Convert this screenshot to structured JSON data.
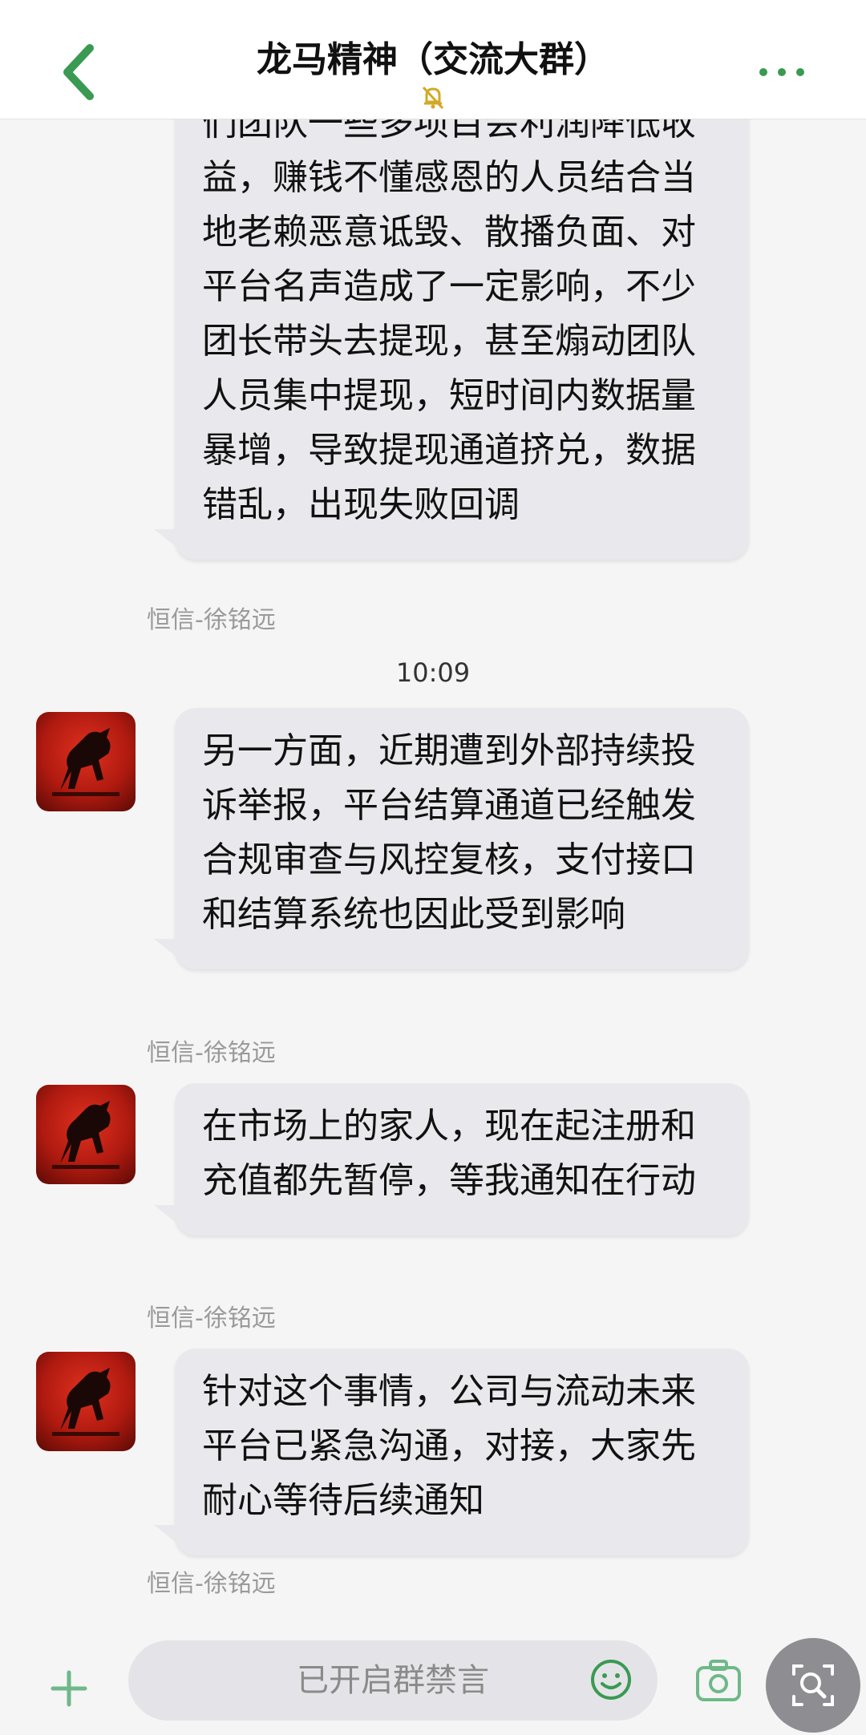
{
  "header": {
    "title": "龙马精神（交流大群）",
    "back_icon": "chevron-left-icon",
    "mute_icon": "bell-off-icon",
    "more_icon": "ellipsis-icon",
    "accent_color": "#3a9a52"
  },
  "messages": [
    {
      "text": "们团队一些多项目会利润降低收益，赚钱不懂感恩的人员结合当地老赖恶意诋毁、散播负面、对平台名声造成了一定影响，不少团长带头去提现，甚至煽动团队人员集中提现，短时间内数据量暴增，导致提现通道挤兑，数据错乱，出现失败回调",
      "sender": "恒信-徐铭远"
    },
    {
      "text": "另一方面，近期遭到外部持续投诉举报，平台结算通道已经触发合规审查与风控复核，支付接口和结算系统也因此受到影响",
      "sender": "恒信-徐铭远"
    },
    {
      "text": "在市场上的家人，现在起注册和充值都先暂停，等我通知在行动",
      "sender": "恒信-徐铭远"
    },
    {
      "text": "针对这个事情，公司与流动未来平台已紧急沟通，对接，大家先耐心等待后续通知",
      "sender": "恒信-徐铭远"
    }
  ],
  "timestamp": "10:09",
  "footer": {
    "input_placeholder": "已开启群禁言",
    "plus_icon": "plus-icon",
    "emoji_icon": "smiley-icon",
    "camera_icon": "camera-icon",
    "lens_icon": "image-search-icon",
    "accent_color": "#3a9a52"
  }
}
